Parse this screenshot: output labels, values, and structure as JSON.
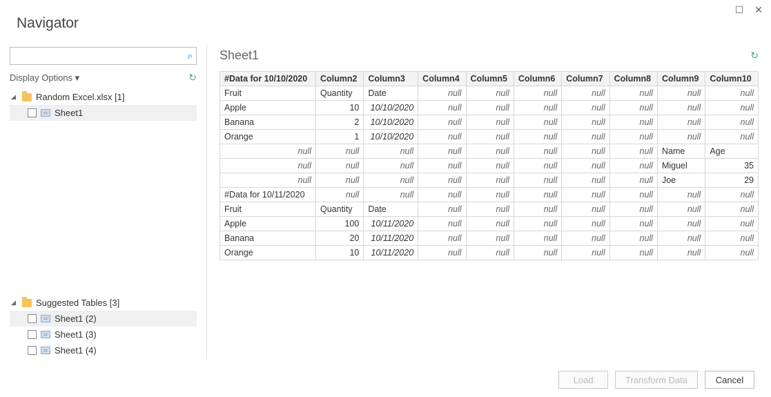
{
  "window": {
    "title": "Navigator",
    "maximize_glyph": "☐",
    "close_glyph": "✕"
  },
  "left": {
    "search_placeholder": "",
    "search_icon": "⌕",
    "display_options_label": "Display Options",
    "display_options_arrow": "▾",
    "refresh_icon": "↻",
    "file_group": {
      "arrow": "◢",
      "label": "Random Excel.xlsx [1]",
      "items": [
        {
          "label": "Sheet1",
          "selected": true
        }
      ]
    },
    "suggested_group": {
      "arrow": "◢",
      "label": "Suggested Tables [3]",
      "items": [
        {
          "label": "Sheet1 (2)",
          "selected": true
        },
        {
          "label": "Sheet1 (3)",
          "selected": false
        },
        {
          "label": "Sheet1 (4)",
          "selected": false
        }
      ]
    }
  },
  "right": {
    "sheet_title": "Sheet1",
    "sheet_action_icon": "↻",
    "columns": [
      "#Data for 10/10/2020",
      "Column2",
      "Column3",
      "Column4",
      "Column5",
      "Column6",
      "Column7",
      "Column8",
      "Column9",
      "Column10"
    ],
    "rows": [
      [
        {
          "v": "Fruit",
          "t": "txt"
        },
        {
          "v": "Quantity",
          "t": "txt"
        },
        {
          "v": "Date",
          "t": "txt"
        },
        {
          "v": "null",
          "t": "null"
        },
        {
          "v": "null",
          "t": "null"
        },
        {
          "v": "null",
          "t": "null"
        },
        {
          "v": "null",
          "t": "null"
        },
        {
          "v": "null",
          "t": "null"
        },
        {
          "v": "null",
          "t": "null"
        },
        {
          "v": "null",
          "t": "null"
        }
      ],
      [
        {
          "v": "Apple",
          "t": "txt"
        },
        {
          "v": "10",
          "t": "num"
        },
        {
          "v": "10/10/2020",
          "t": "date"
        },
        {
          "v": "null",
          "t": "null"
        },
        {
          "v": "null",
          "t": "null"
        },
        {
          "v": "null",
          "t": "null"
        },
        {
          "v": "null",
          "t": "null"
        },
        {
          "v": "null",
          "t": "null"
        },
        {
          "v": "null",
          "t": "null"
        },
        {
          "v": "null",
          "t": "null"
        }
      ],
      [
        {
          "v": "Banana",
          "t": "txt"
        },
        {
          "v": "2",
          "t": "num"
        },
        {
          "v": "10/10/2020",
          "t": "date"
        },
        {
          "v": "null",
          "t": "null"
        },
        {
          "v": "null",
          "t": "null"
        },
        {
          "v": "null",
          "t": "null"
        },
        {
          "v": "null",
          "t": "null"
        },
        {
          "v": "null",
          "t": "null"
        },
        {
          "v": "null",
          "t": "null"
        },
        {
          "v": "null",
          "t": "null"
        }
      ],
      [
        {
          "v": "Orange",
          "t": "txt"
        },
        {
          "v": "1",
          "t": "num"
        },
        {
          "v": "10/10/2020",
          "t": "date"
        },
        {
          "v": "null",
          "t": "null"
        },
        {
          "v": "null",
          "t": "null"
        },
        {
          "v": "null",
          "t": "null"
        },
        {
          "v": "null",
          "t": "null"
        },
        {
          "v": "null",
          "t": "null"
        },
        {
          "v": "null",
          "t": "null"
        },
        {
          "v": "null",
          "t": "null"
        }
      ],
      [
        {
          "v": "null",
          "t": "null"
        },
        {
          "v": "null",
          "t": "null"
        },
        {
          "v": "null",
          "t": "null"
        },
        {
          "v": "null",
          "t": "null"
        },
        {
          "v": "null",
          "t": "null"
        },
        {
          "v": "null",
          "t": "null"
        },
        {
          "v": "null",
          "t": "null"
        },
        {
          "v": "null",
          "t": "null"
        },
        {
          "v": "Name",
          "t": "txt"
        },
        {
          "v": "Age",
          "t": "txt"
        }
      ],
      [
        {
          "v": "null",
          "t": "null"
        },
        {
          "v": "null",
          "t": "null"
        },
        {
          "v": "null",
          "t": "null"
        },
        {
          "v": "null",
          "t": "null"
        },
        {
          "v": "null",
          "t": "null"
        },
        {
          "v": "null",
          "t": "null"
        },
        {
          "v": "null",
          "t": "null"
        },
        {
          "v": "null",
          "t": "null"
        },
        {
          "v": "Miguel",
          "t": "txt"
        },
        {
          "v": "35",
          "t": "num"
        }
      ],
      [
        {
          "v": "null",
          "t": "null"
        },
        {
          "v": "null",
          "t": "null"
        },
        {
          "v": "null",
          "t": "null"
        },
        {
          "v": "null",
          "t": "null"
        },
        {
          "v": "null",
          "t": "null"
        },
        {
          "v": "null",
          "t": "null"
        },
        {
          "v": "null",
          "t": "null"
        },
        {
          "v": "null",
          "t": "null"
        },
        {
          "v": "Joe",
          "t": "txt"
        },
        {
          "v": "29",
          "t": "num"
        }
      ],
      [
        {
          "v": "#Data for 10/11/2020",
          "t": "txt"
        },
        {
          "v": "null",
          "t": "null"
        },
        {
          "v": "null",
          "t": "null"
        },
        {
          "v": "null",
          "t": "null"
        },
        {
          "v": "null",
          "t": "null"
        },
        {
          "v": "null",
          "t": "null"
        },
        {
          "v": "null",
          "t": "null"
        },
        {
          "v": "null",
          "t": "null"
        },
        {
          "v": "null",
          "t": "null"
        },
        {
          "v": "null",
          "t": "null"
        }
      ],
      [
        {
          "v": "Fruit",
          "t": "txt"
        },
        {
          "v": "Quantity",
          "t": "txt"
        },
        {
          "v": "Date",
          "t": "txt"
        },
        {
          "v": "null",
          "t": "null"
        },
        {
          "v": "null",
          "t": "null"
        },
        {
          "v": "null",
          "t": "null"
        },
        {
          "v": "null",
          "t": "null"
        },
        {
          "v": "null",
          "t": "null"
        },
        {
          "v": "null",
          "t": "null"
        },
        {
          "v": "null",
          "t": "null"
        }
      ],
      [
        {
          "v": "Apple",
          "t": "txt"
        },
        {
          "v": "100",
          "t": "num"
        },
        {
          "v": "10/11/2020",
          "t": "date"
        },
        {
          "v": "null",
          "t": "null"
        },
        {
          "v": "null",
          "t": "null"
        },
        {
          "v": "null",
          "t": "null"
        },
        {
          "v": "null",
          "t": "null"
        },
        {
          "v": "null",
          "t": "null"
        },
        {
          "v": "null",
          "t": "null"
        },
        {
          "v": "null",
          "t": "null"
        }
      ],
      [
        {
          "v": "Banana",
          "t": "txt"
        },
        {
          "v": "20",
          "t": "num"
        },
        {
          "v": "10/11/2020",
          "t": "date"
        },
        {
          "v": "null",
          "t": "null"
        },
        {
          "v": "null",
          "t": "null"
        },
        {
          "v": "null",
          "t": "null"
        },
        {
          "v": "null",
          "t": "null"
        },
        {
          "v": "null",
          "t": "null"
        },
        {
          "v": "null",
          "t": "null"
        },
        {
          "v": "null",
          "t": "null"
        }
      ],
      [
        {
          "v": "Orange",
          "t": "txt"
        },
        {
          "v": "10",
          "t": "num"
        },
        {
          "v": "10/11/2020",
          "t": "date"
        },
        {
          "v": "null",
          "t": "null"
        },
        {
          "v": "null",
          "t": "null"
        },
        {
          "v": "null",
          "t": "null"
        },
        {
          "v": "null",
          "t": "null"
        },
        {
          "v": "null",
          "t": "null"
        },
        {
          "v": "null",
          "t": "null"
        },
        {
          "v": "null",
          "t": "null"
        }
      ]
    ]
  },
  "footer": {
    "load": "Load",
    "transform": "Transform Data",
    "cancel": "Cancel"
  }
}
